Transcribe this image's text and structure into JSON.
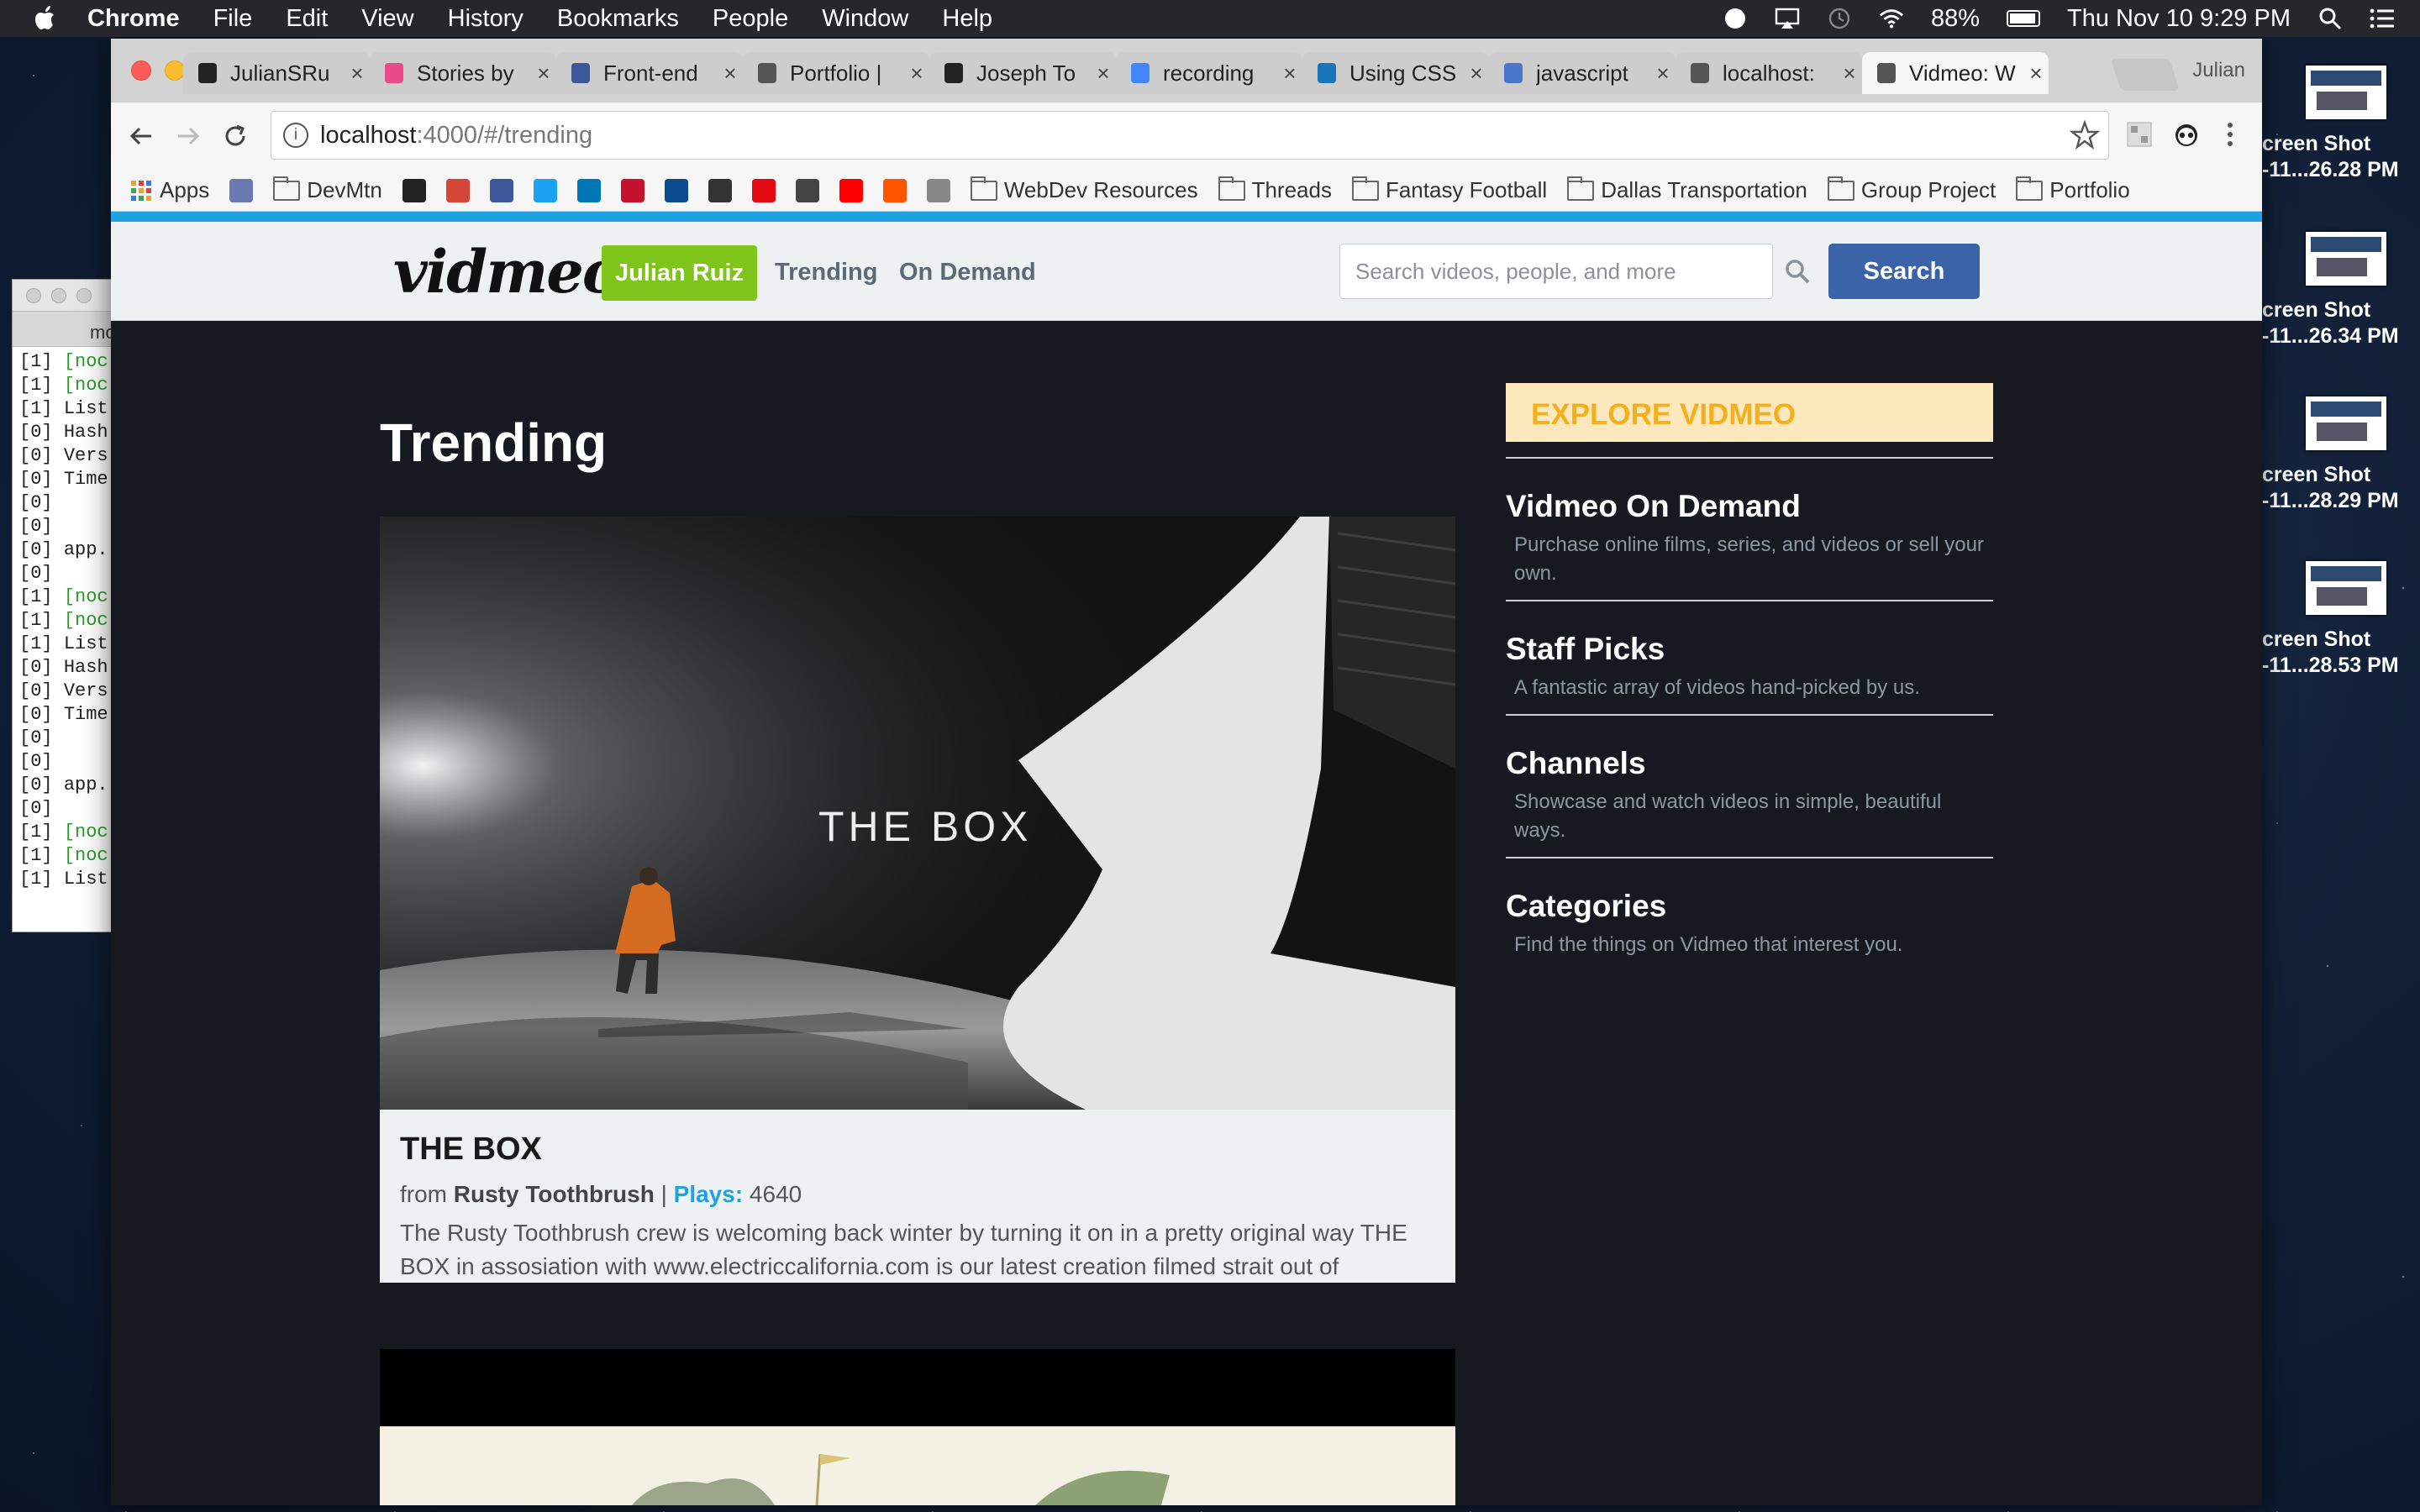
{
  "menubar": {
    "app": "Chrome",
    "items": [
      "File",
      "Edit",
      "View",
      "History",
      "Bookmarks",
      "People",
      "Window",
      "Help"
    ],
    "battery": "88%",
    "clock": "Thu Nov 10  9:29 PM"
  },
  "terminal": {
    "tab_label": "mo",
    "lines": [
      {
        "p": "[1]",
        "t": "[noc",
        "green": true
      },
      {
        "p": "[1]",
        "t": "[noc",
        "green": true
      },
      {
        "p": "[1]",
        "t": "List",
        "green": false
      },
      {
        "p": "[0]",
        "t": "Hash",
        "green": false
      },
      {
        "p": "[0]",
        "t": "Vers",
        "green": false
      },
      {
        "p": "[0]",
        "t": "Time",
        "green": false
      },
      {
        "p": "[0]",
        "t": "",
        "green": false
      },
      {
        "p": "[0]",
        "t": "",
        "green": false
      },
      {
        "p": "[0]",
        "t": "app.",
        "green": false
      },
      {
        "p": "[0]",
        "t": "",
        "green": false
      },
      {
        "p": "[1]",
        "t": "[noc",
        "green": true
      },
      {
        "p": "[1]",
        "t": "[noc",
        "green": true
      },
      {
        "p": "[1]",
        "t": "List",
        "green": false
      },
      {
        "p": "[0]",
        "t": "Hash",
        "green": false
      },
      {
        "p": "[0]",
        "t": "Vers",
        "green": false
      },
      {
        "p": "[0]",
        "t": "Time",
        "green": false
      },
      {
        "p": "[0]",
        "t": "",
        "green": false
      },
      {
        "p": "[0]",
        "t": "",
        "green": false
      },
      {
        "p": "[0]",
        "t": "app.",
        "green": false
      },
      {
        "p": "[0]",
        "t": "",
        "green": false
      },
      {
        "p": "[1]",
        "t": "[noc",
        "green": true
      },
      {
        "p": "[1]",
        "t": "[noc",
        "green": true
      },
      {
        "p": "[1]",
        "t": "List",
        "green": false
      }
    ]
  },
  "desktop_icons": [
    {
      "line1": "creen Shot",
      "line2": "-11...26.28 PM"
    },
    {
      "line1": "creen Shot",
      "line2": "-11...26.34 PM"
    },
    {
      "line1": "creen Shot",
      "line2": "-11...28.29 PM"
    },
    {
      "line1": "creen Shot",
      "line2": "-11...28.53 PM"
    }
  ],
  "browser": {
    "tabs": [
      {
        "title": "JulianSRu",
        "icon": "github-icon",
        "color": "#222222"
      },
      {
        "title": "Stories by",
        "icon": "dribbble-icon",
        "color": "#ea4c89"
      },
      {
        "title": "Front-end",
        "icon": "file-icon",
        "color": "#3b5998"
      },
      {
        "title": "Portfolio |",
        "icon": "document-icon",
        "color": "#555555"
      },
      {
        "title": "Joseph To",
        "icon": "jt-logo-icon",
        "color": "#222222"
      },
      {
        "title": "recording",
        "icon": "google-icon",
        "color": "#4285f4"
      },
      {
        "title": "Using CSS",
        "icon": "css-icon",
        "color": "#1b75bb"
      },
      {
        "title": "javascript",
        "icon": "docs-icon",
        "color": "#4a76c9"
      },
      {
        "title": "localhost:",
        "icon": "document-icon",
        "color": "#555555"
      },
      {
        "title": "Vidmeo: W",
        "icon": "document-icon",
        "color": "#555555"
      }
    ],
    "profile": "Julian",
    "url_host": "localhost",
    "url_rest": ":4000/#/trending",
    "bookmarks": [
      {
        "label": "Apps",
        "type": "apps"
      },
      {
        "label": "",
        "type": "icon",
        "color": "#6a7ab0"
      },
      {
        "label": "DevMtn",
        "type": "folder"
      },
      {
        "label": "",
        "type": "icon",
        "color": "#222222"
      },
      {
        "label": "",
        "type": "icon",
        "color": "#d44638"
      },
      {
        "label": "",
        "type": "icon",
        "color": "#3b5998"
      },
      {
        "label": "",
        "type": "icon",
        "color": "#1da1f2"
      },
      {
        "label": "",
        "type": "icon",
        "color": "#0077b5"
      },
      {
        "label": "",
        "type": "icon",
        "color": "#c4122f"
      },
      {
        "label": "",
        "type": "icon",
        "color": "#0b4a8f"
      },
      {
        "label": "",
        "type": "icon",
        "color": "#333333"
      },
      {
        "label": "",
        "type": "icon",
        "color": "#e50914"
      },
      {
        "label": "",
        "type": "icon",
        "color": "#444444"
      },
      {
        "label": "",
        "type": "icon",
        "color": "#ff0000"
      },
      {
        "label": "",
        "type": "icon",
        "color": "#ff5500"
      },
      {
        "label": "",
        "type": "icon",
        "color": "#888888"
      },
      {
        "label": "WebDev Resources",
        "type": "folder"
      },
      {
        "label": "Threads",
        "type": "folder"
      },
      {
        "label": "Fantasy Football",
        "type": "folder"
      },
      {
        "label": "Dallas Transportation",
        "type": "folder"
      },
      {
        "label": "Group Project",
        "type": "folder"
      },
      {
        "label": "Portfolio",
        "type": "folder"
      }
    ]
  },
  "site": {
    "logo": "vidmeo",
    "user_button": "Julian Ruiz",
    "nav": [
      "Trending",
      "On Demand"
    ],
    "search_placeholder": "Search videos, people, and more",
    "search_button": "Search",
    "heading": "Trending",
    "video": {
      "thumb_text": "THE BOX",
      "title": "THE BOX",
      "from_label": "from",
      "author": "Rusty Toothbrush",
      "separator": "|",
      "plays_label": "Plays:",
      "plays": "4640",
      "description": "The Rusty Toothbrush crew is welcoming back winter by turning it on in a pretty original way THE BOX in assosiation with www.electriccalifornia.com is our latest creation filmed strait out of"
    },
    "explore_title": "EXPLORE VIDMEO",
    "sidebar": [
      {
        "title": "Vidmeo On Demand",
        "desc": "Purchase online films, series, and videos or sell your own."
      },
      {
        "title": "Staff Picks",
        "desc": "A fantastic array of videos hand-picked by us."
      },
      {
        "title": "Channels",
        "desc": "Showcase and watch videos in simple, beautiful ways."
      },
      {
        "title": "Categories",
        "desc": "Find the things on Vidmeo that interest you."
      }
    ]
  }
}
